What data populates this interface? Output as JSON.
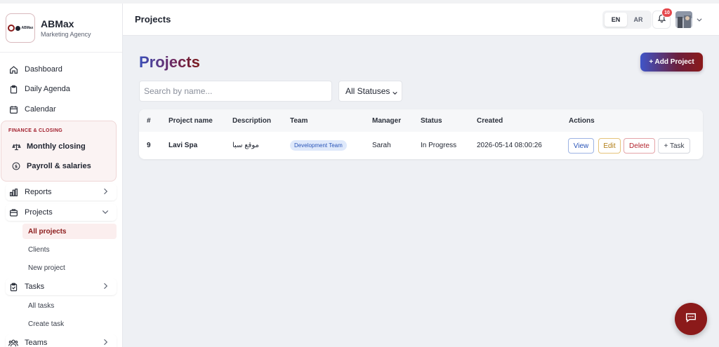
{
  "brand": {
    "logo_text": "ABMax",
    "name": "ABMax",
    "subtitle": "Marketing Agency"
  },
  "sidebar": {
    "items": [
      {
        "label": "Dashboard",
        "icon": "home-icon"
      },
      {
        "label": "Daily Agenda",
        "icon": "clipboard-icon"
      },
      {
        "label": "Calendar",
        "icon": "calendar-icon"
      }
    ],
    "finance": {
      "title": "FINANCE & CLOSING",
      "items": [
        {
          "label": "Monthly closing",
          "icon": "scale-icon"
        },
        {
          "label": "Payroll & salaries",
          "icon": "dollar-circle-icon"
        }
      ]
    },
    "reports": {
      "label": "Reports",
      "icon": "bar-chart-icon"
    },
    "projects": {
      "label": "Projects",
      "icon": "folder-icon",
      "sub": [
        "All projects",
        "Clients",
        "New project"
      ]
    },
    "tasks": {
      "label": "Tasks",
      "icon": "clipboard-check-icon",
      "sub": [
        "All tasks",
        "Create task"
      ]
    },
    "teams": {
      "label": "Teams",
      "icon": "users-icon"
    }
  },
  "header": {
    "title": "Projects",
    "lang": [
      "EN",
      "AR"
    ],
    "lang_active": "EN",
    "notifications": "10"
  },
  "main": {
    "title": "Projects",
    "add_button": "+ Add Project",
    "search_placeholder": "Search by name...",
    "status_filter": "All Statuses",
    "table": {
      "headers": [
        "#",
        "Project name",
        "Description",
        "Team",
        "Manager",
        "Status",
        "Created",
        "Actions"
      ],
      "rows": [
        {
          "id": "9",
          "name": "Lavi Spa",
          "description": "موقع سبا",
          "team": "Development Team",
          "manager": "Sarah",
          "status": "In Progress",
          "created": "2026-05-14 08:00:26",
          "actions": [
            "View",
            "Edit",
            "Delete",
            "+ Task"
          ]
        }
      ]
    }
  },
  "colors": {
    "brand": "#8b1a1a",
    "accent_blue": "#3f55c8",
    "badge_red": "#e5484d"
  }
}
